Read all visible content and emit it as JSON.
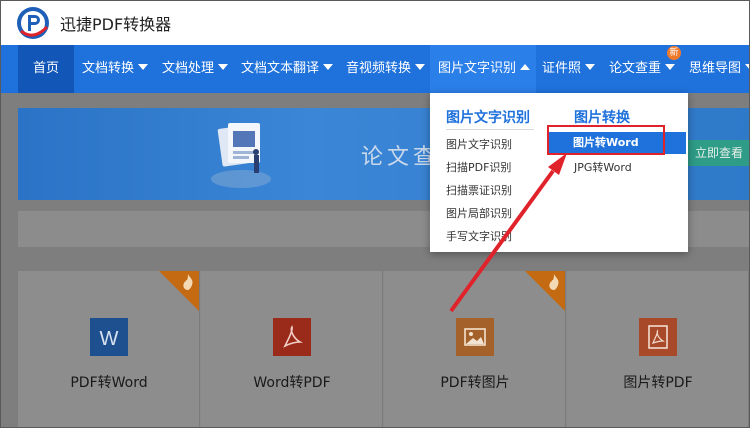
{
  "app": {
    "title": "迅捷PDF转换器"
  },
  "nav": {
    "items": [
      {
        "label": "首页",
        "has_arrow": false
      },
      {
        "label": "文档转换",
        "has_arrow": true
      },
      {
        "label": "文档处理",
        "has_arrow": true
      },
      {
        "label": "文档文本翻译",
        "has_arrow": true
      },
      {
        "label": "音视频转换",
        "has_arrow": true
      },
      {
        "label": "图片文字识别",
        "has_arrow": true,
        "expanded": true
      },
      {
        "label": "证件照",
        "has_arrow": true
      },
      {
        "label": "论文查重",
        "has_arrow": true
      },
      {
        "label": "思维导图",
        "has_arrow": true
      }
    ],
    "new_badge": "新"
  },
  "dropdown": {
    "col1": {
      "title": "图片文字识别",
      "items": [
        "图片文字识别",
        "扫描PDF识别",
        "扫描票证识别",
        "图片局部识别",
        "手写文字识别"
      ]
    },
    "col2": {
      "title": "图片转换",
      "items": [
        "图片转Word",
        "JPG转Word"
      ],
      "selected": "图片转Word"
    }
  },
  "banner": {
    "text": "论文查",
    "button": "立即查看"
  },
  "cards": [
    {
      "label": "PDF转Word",
      "icon": "word-icon",
      "hot": true
    },
    {
      "label": "Word转PDF",
      "icon": "pdf-icon",
      "hot": false
    },
    {
      "label": "PDF转图片",
      "icon": "image-icon",
      "hot": true
    },
    {
      "label": "图片转PDF",
      "icon": "pdf-icon",
      "hot": false
    }
  ],
  "colors": {
    "nav_bg": "#1f72dc",
    "accent_red": "#e0222a",
    "hot_orange": "#c46a12"
  }
}
